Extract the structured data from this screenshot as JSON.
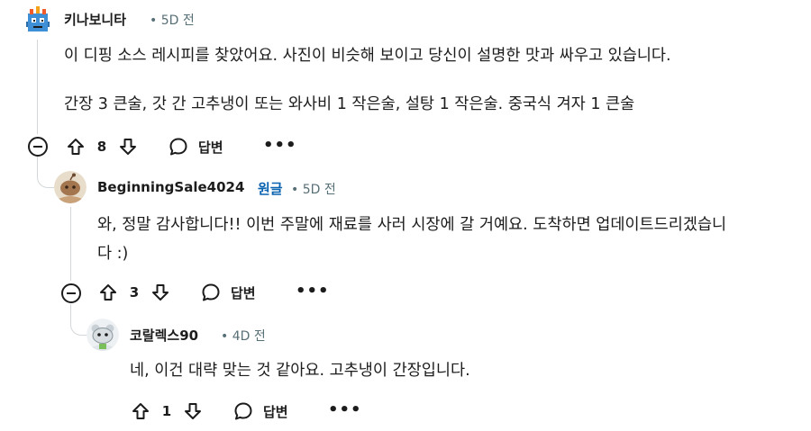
{
  "colors": {
    "text": "#1c1c1c",
    "meta": "#576f76",
    "op_badge": "#0a63b0",
    "thread_line": "#d4d7da"
  },
  "comments": [
    {
      "username": "키나보니타",
      "meta": "• 5D 전",
      "avatar_icon": "pixel-avatar-icon",
      "lines": [
        "이 디핑 소스 레시피를 찾았어요. 사진이 비슷해 보이고 당신이 설명한 맛과 싸우고 있습니다.",
        "간장 3 큰술, 갓 간 고추냉이 또는 와사비 1 작은술, 설탕 1 작은술. 중국식 겨자 1 큰술"
      ],
      "votes": "8",
      "reply_label": "답변",
      "more": "•••"
    },
    {
      "username": "BeginningSale4024",
      "op_badge": "원글",
      "meta": "• 5D 전",
      "avatar_icon": "snoo-avatar-icon",
      "lines": [
        "와, 정말 감사합니다!! 이번 주말에 재료를 사러 시장에 갈 거예요. 도착하면 업데이트드리겠습니",
        "다 :)"
      ],
      "votes": "3",
      "reply_label": "답변",
      "more": "•••"
    },
    {
      "username": "코랄렉스90",
      "meta": "• 4D 전",
      "avatar_icon": "snoo-avatar-icon",
      "lines": [
        "네, 이건 대략 맞는 것 같아요. 고추냉이 간장입니다."
      ],
      "votes": "1",
      "reply_label": "답변",
      "more": "•••"
    }
  ]
}
